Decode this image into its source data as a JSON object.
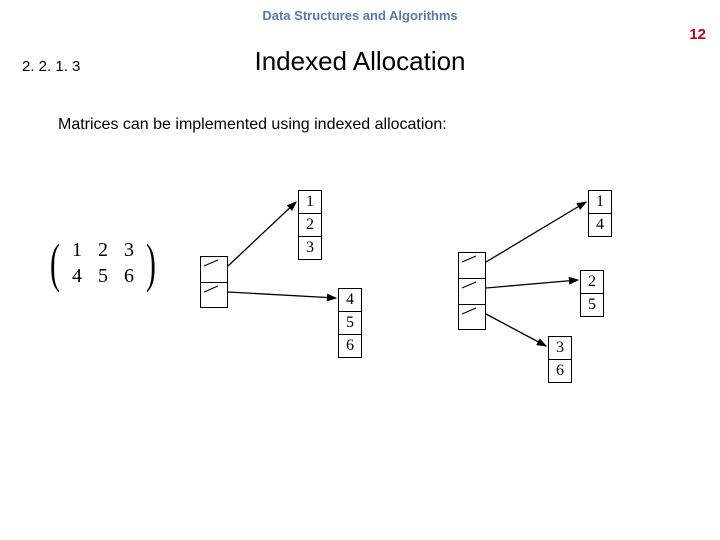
{
  "header": {
    "course": "Data Structures and Algorithms",
    "page_number": "12"
  },
  "section": "2. 2. 1. 3",
  "title": "Indexed Allocation",
  "body": "Matrices can be implemented using indexed allocation:",
  "matrix": {
    "r0c0": "1",
    "r0c1": "2",
    "r0c2": "3",
    "r1c0": "4",
    "r1c1": "5",
    "r1c2": "6"
  },
  "diagram": {
    "left_col_a": [
      "1",
      "2",
      "3"
    ],
    "left_col_b": [
      "4",
      "5",
      "6"
    ],
    "right_col_a": [
      "1",
      "4"
    ],
    "right_col_b": [
      "2",
      "5"
    ],
    "right_col_c": [
      "3",
      "6"
    ]
  }
}
